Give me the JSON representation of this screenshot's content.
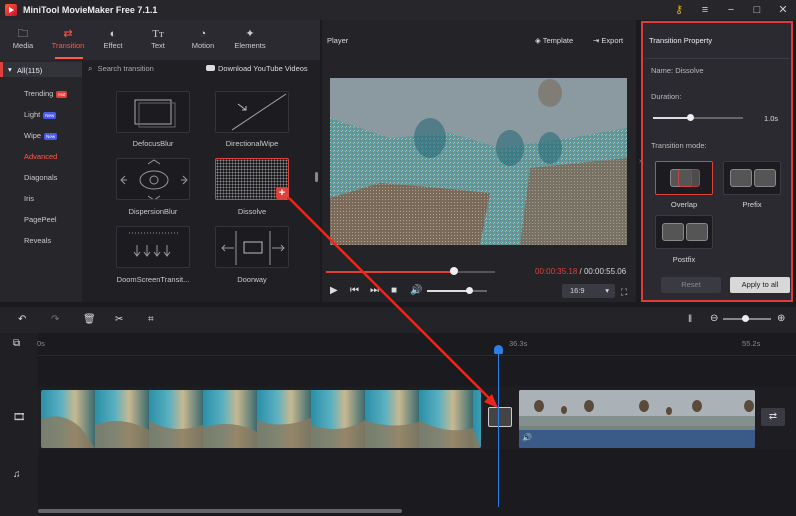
{
  "app": {
    "title": "MiniTool MovieMaker Free 7.1.1"
  },
  "toolbar": {
    "tabs": [
      {
        "label": "Media",
        "icon": "folder-icon"
      },
      {
        "label": "Transition",
        "icon": "transition-arrows-icon"
      },
      {
        "label": "Effect",
        "icon": "effect-icon"
      },
      {
        "label": "Text",
        "icon": "text-icon"
      },
      {
        "label": "Motion",
        "icon": "motion-icon"
      },
      {
        "label": "Elements",
        "icon": "elements-icon"
      }
    ],
    "active": "Transition"
  },
  "sidebar": {
    "header": "All(115)",
    "items": [
      {
        "label": "Trending",
        "badge": "Hot"
      },
      {
        "label": "Light",
        "badge": "New"
      },
      {
        "label": "Wipe",
        "badge": "New"
      },
      {
        "label": "Advanced",
        "badge": ""
      },
      {
        "label": "Diagonals",
        "badge": ""
      },
      {
        "label": "Iris",
        "badge": ""
      },
      {
        "label": "PagePeel",
        "badge": ""
      },
      {
        "label": "Reveals",
        "badge": ""
      }
    ],
    "active": "Advanced"
  },
  "library": {
    "search_placeholder": "Search transition",
    "download_label": "Download YouTube Videos",
    "items": [
      {
        "label": "DefocusBlur"
      },
      {
        "label": "DirectionalWipe"
      },
      {
        "label": "DispersionBlur"
      },
      {
        "label": "Dissolve"
      },
      {
        "label": "DoomScreenTransit..."
      },
      {
        "label": "Doorway"
      }
    ],
    "selected": "Dissolve"
  },
  "player": {
    "title": "Player",
    "template_label": "Template",
    "export_label": "Export",
    "current_time": "00:00:35.18",
    "separator": " / ",
    "total_time": "00:00:55.06",
    "aspect_ratio": "16:9",
    "progress": 0.76,
    "volume": 0.7
  },
  "transition_property": {
    "title": "Transition Property",
    "name_label": "Name:",
    "name_value": "Dissolve",
    "duration_label": "Duration:",
    "duration_value": "1.0s",
    "mode_label": "Transition mode:",
    "modes": [
      "Overlap",
      "Prefix",
      "Postfix"
    ],
    "selected_mode": "Overlap",
    "reset_label": "Reset",
    "apply_all_label": "Apply to all"
  },
  "timeline": {
    "ruler_labels": [
      "0s",
      "36.3s",
      "55.2s"
    ],
    "zoom": 0.45
  },
  "colors": {
    "accent": "#e0403a",
    "playhead": "#2a7fe8",
    "panel": "#2a2a30"
  }
}
